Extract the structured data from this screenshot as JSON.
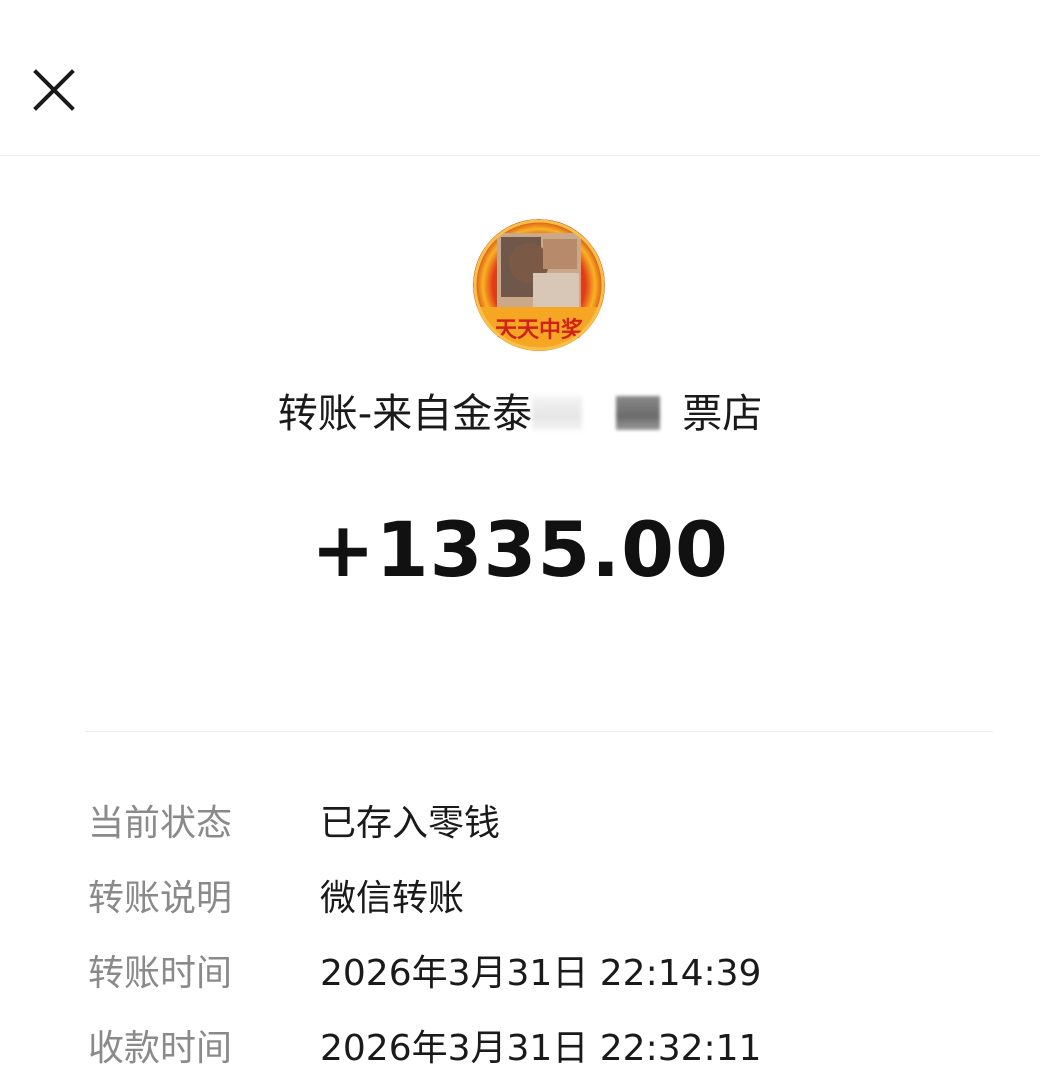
{
  "header": {
    "close_icon": "close-icon"
  },
  "transfer": {
    "avatar_caption": "天天中奖",
    "sender_prefix": "转账-来自金泰",
    "sender_suffix": "票店",
    "amount": "+1335.00"
  },
  "details": [
    {
      "label": "当前状态",
      "value": "已存入零钱"
    },
    {
      "label": "转账说明",
      "value": "微信转账"
    },
    {
      "label": "转账时间",
      "value": "2026年3月31日 22:14:39"
    },
    {
      "label": "收款时间",
      "value": "2026年3月31日 22:32:11"
    }
  ],
  "colors": {
    "label": "#8a8a8a",
    "text": "#1a1a1a",
    "divider": "#ececec",
    "avatar_ring": "#f2a521",
    "avatar_caption": "#d0201a"
  }
}
